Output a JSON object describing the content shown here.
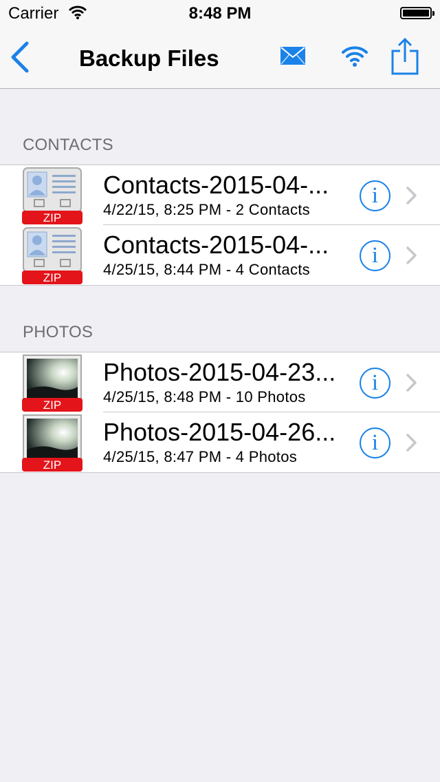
{
  "status_bar": {
    "carrier": "Carrier",
    "time": "8:48 PM"
  },
  "nav": {
    "title": "Backup Files",
    "accent": "#1a82e8"
  },
  "sections": [
    {
      "header": "CONTACTS",
      "rows": [
        {
          "title": "Contacts-2015-04-...",
          "subtitle": "4/22/15, 8:25 PM - 2 Contacts",
          "badge": "ZIP"
        },
        {
          "title": "Contacts-2015-04-...",
          "subtitle": "4/25/15, 8:44 PM - 4 Contacts",
          "badge": "ZIP"
        }
      ]
    },
    {
      "header": "PHOTOS",
      "rows": [
        {
          "title": "Photos-2015-04-23...",
          "subtitle": "4/25/15, 8:48 PM - 10 Photos",
          "badge": "ZIP"
        },
        {
          "title": "Photos-2015-04-26...",
          "subtitle": "4/25/15, 8:47 PM - 4 Photos",
          "badge": "ZIP"
        }
      ]
    }
  ],
  "info_glyph": "i",
  "icons": [
    "back-chevron-icon",
    "mail-icon",
    "wifi-icon",
    "share-icon",
    "info-icon",
    "chevron-right-icon",
    "contact-zip-icon",
    "photo-zip-icon"
  ]
}
